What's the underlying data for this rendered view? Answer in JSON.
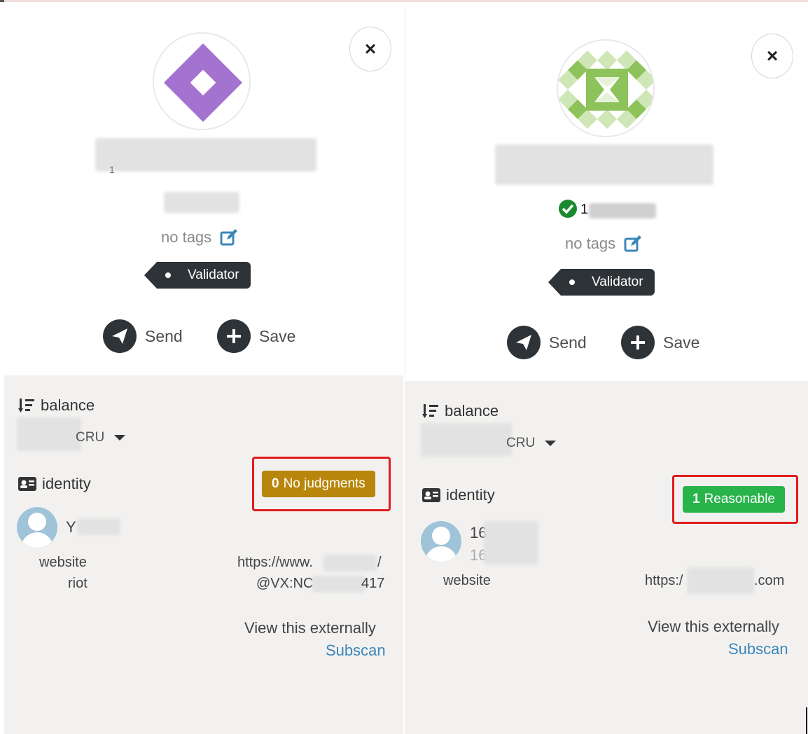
{
  "left": {
    "close_label": "×",
    "blurred_name": "1",
    "tags_text": "no tags",
    "role_tag": "Validator",
    "send_label": "Send",
    "save_label": "Save",
    "balance_label": "balance",
    "currency": "CRU",
    "identity_label": "identity",
    "judgment_count": "0",
    "judgment_label": "No judgments",
    "judgment_color": "#b8860b",
    "display_name": "Y",
    "fields": [
      {
        "key": "website",
        "value": "https://www."
      },
      {
        "key": "riot",
        "value": "@VX:NC"
      }
    ],
    "url_tail": "/",
    "riot_tail": "417",
    "view_external": "View this externally",
    "subscan": "Subscan"
  },
  "right": {
    "close_label": "×",
    "address_prefix": "1",
    "tags_text": "no tags",
    "role_tag": "Validator",
    "send_label": "Send",
    "save_label": "Save",
    "balance_label": "balance",
    "currency": "CRU",
    "identity_label": "identity",
    "judgment_count": "1",
    "judgment_label": "Reasonable",
    "judgment_color": "#28b44a",
    "name_line1": "16",
    "name_line2": "16",
    "fields": [
      {
        "key": "website",
        "value": "https:/"
      }
    ],
    "url_tail": ".com",
    "view_external": "View this externally",
    "subscan": "Subscan"
  }
}
